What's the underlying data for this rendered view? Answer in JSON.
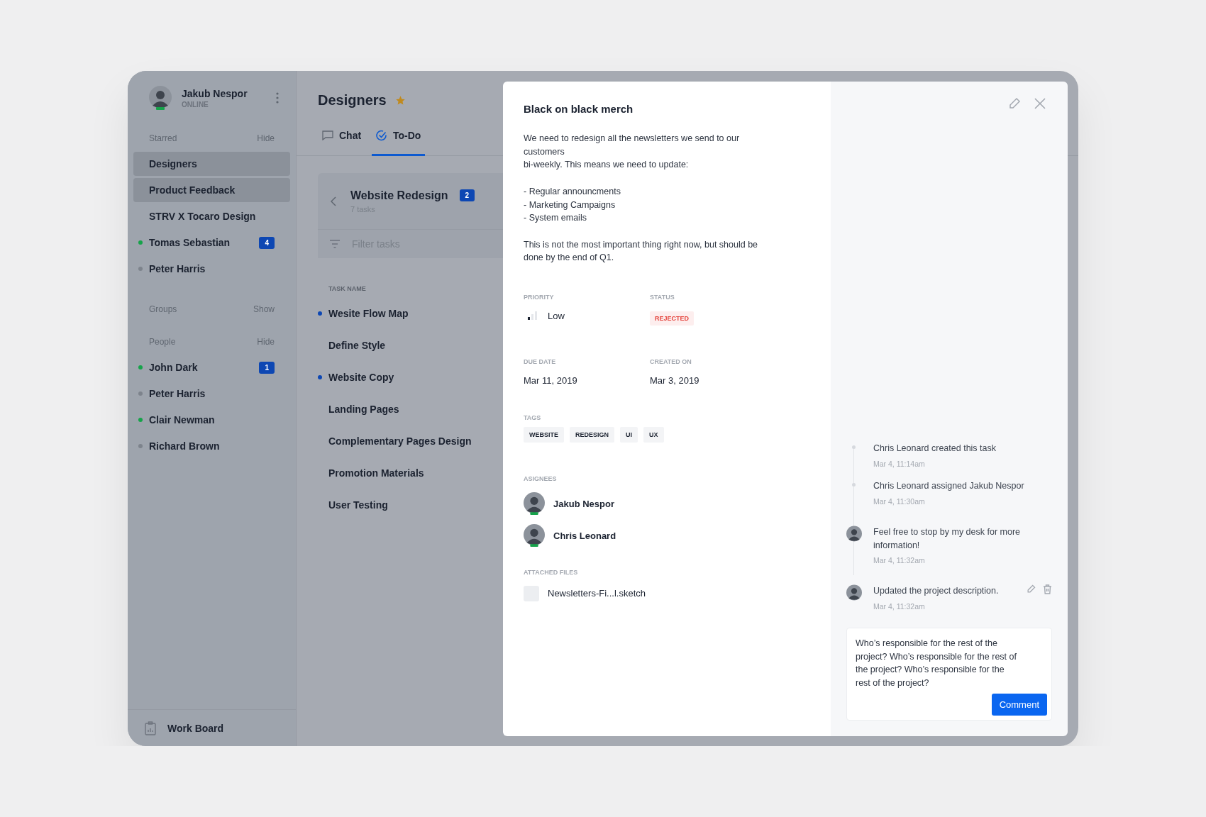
{
  "user": {
    "name": "Jakub Nespor",
    "status": "ONLINE",
    "online": true
  },
  "starred": {
    "label": "Starred",
    "action": "Hide",
    "items": [
      {
        "name": "Designers",
        "highlighted": true
      },
      {
        "name": "Product Feedback",
        "highlighted": true
      },
      {
        "name": "STRV X Tocaro Design",
        "highlighted": false
      },
      {
        "name": "Tomas Sebastian",
        "highlighted": false,
        "online": true,
        "badge": "4"
      },
      {
        "name": "Peter Harris",
        "highlighted": false,
        "online": false
      }
    ]
  },
  "groups": {
    "label": "Groups",
    "action": "Show"
  },
  "people": {
    "label": "People",
    "action": "Hide",
    "items": [
      {
        "name": "John Dark",
        "online": true,
        "badge": "1"
      },
      {
        "name": "Peter Harris",
        "online": false
      },
      {
        "name": "Clair Newman",
        "online": true
      },
      {
        "name": "Richard Brown",
        "online": false
      }
    ]
  },
  "footer": {
    "label": "Work Board"
  },
  "channel": {
    "title": "Designers",
    "starred": true
  },
  "tabs": [
    {
      "label": "Chat",
      "kind": "chat",
      "selected": false
    },
    {
      "label": "To-Do",
      "kind": "todo",
      "selected": true
    }
  ],
  "list": {
    "title": "Website Redesign",
    "badge": "2",
    "subtitle": "7 tasks",
    "filter_placeholder": "Filter tasks",
    "column": "TASK NAME"
  },
  "tasks": [
    {
      "name": "Wesite Flow Map",
      "unread": true
    },
    {
      "name": "Define Style",
      "unread": false
    },
    {
      "name": "Website Copy",
      "unread": true
    },
    {
      "name": "Landing Pages",
      "unread": false
    },
    {
      "name": "Complementary Pages Design",
      "unread": false
    },
    {
      "name": "Promotion Materials",
      "unread": false
    },
    {
      "name": "User Testing",
      "unread": false
    }
  ],
  "task": {
    "title": "Black on black merch",
    "description": [
      [
        "We need to redesign all the newsletters we send to our",
        "customers",
        "bi-weekly. This means we need to update:"
      ],
      [
        "- Regular announcments",
        "- Marketing Campaigns",
        "- System emails"
      ],
      [
        "This is not the most important thing right now, but should be",
        "done by the end of Q1."
      ]
    ],
    "priority_label": "PRIORITY",
    "priority": {
      "text": "Low",
      "level": 0.33
    },
    "status_label": "STATUS",
    "status": "REJECTED",
    "due_label": "DUE DATE",
    "due": "Mar 11, 2019",
    "created_label": "CREATED ON",
    "created": "Mar 3, 2019",
    "tags_label": "TAGS",
    "tags": [
      "WEBSITE",
      "REDESIGN",
      "UI",
      "UX"
    ],
    "assignees_label": "ASIGNEES",
    "assignees": [
      {
        "name": "Jakub Nespor",
        "online": true
      },
      {
        "name": "Chris Leonard",
        "online": true
      }
    ],
    "files_label": "ATTACHED FILES",
    "files": [
      "Newsletters-Fi...l.sketch"
    ]
  },
  "activity": [
    {
      "kind": "event",
      "text": "Chris Leonard created this task",
      "time": "Mar 4, 11:14am"
    },
    {
      "kind": "event",
      "text": "Chris Leonard assigned Jakub Nespor",
      "time": "Mar 4, 11:30am"
    },
    {
      "kind": "comment",
      "text": "Feel free to stop by my desk for more information!",
      "time": "Mar 4, 11:32am",
      "editable": false
    },
    {
      "kind": "comment",
      "text": "Updated the project description.",
      "time": "Mar 4, 11:32am",
      "editable": true
    }
  ],
  "comment": {
    "value": "Who’s responsible for the rest of the project? Who’s responsible for the rest of the project? Who’s responsible for the rest of the project?",
    "button": "Comment"
  }
}
